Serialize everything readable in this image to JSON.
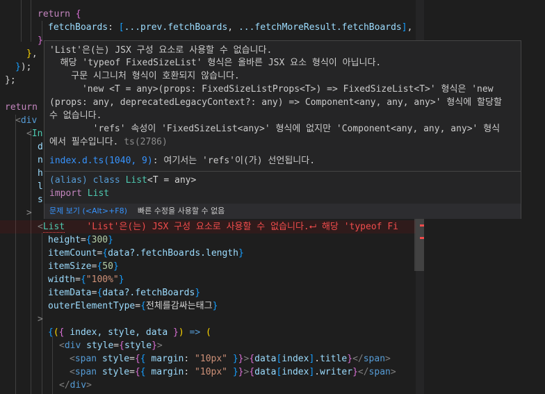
{
  "code": {
    "return_kw": "return",
    "fetchBoards_key": "fetchBoards",
    "spread_prev": "...prev.fetchBoards",
    "spread_more": "...fetchMoreResult.fetchBoards",
    "return2_kw": "return",
    "div_tag": "div",
    "infinite_tag": "In",
    "props_left": [
      "d",
      "n",
      "h",
      "l",
      "s"
    ],
    "list_tag": "List",
    "inline_error": "'List'은(는) JSX 구성 요소로 사용할 수 없습니다.⮠ 해당 'typeof Fi",
    "height_attr": "height",
    "height_val": "300",
    "itemCount_attr": "itemCount",
    "itemCount_val": "data?.fetchBoards.length",
    "itemSize_attr": "itemSize",
    "itemSize_val": "50",
    "width_attr": "width",
    "width_val": "\"100%\"",
    "itemData_attr": "itemData",
    "itemData_val": "data?.fetchBoards",
    "outer_attr": "outerElementType",
    "outer_val": "전체를감싸는태그",
    "render_params": "index, style, data",
    "div2_tag": "div",
    "style_attr": "style",
    "style_val": "style",
    "span_tag": "span",
    "margin_key": "margin",
    "margin_val": "\"10px\"",
    "title_prop": "title",
    "writer_prop": "writer",
    "data_var": "data",
    "index_var": "index"
  },
  "hover": {
    "line1": "'List'은(는) JSX 구성 요소로 사용할 수 없습니다.",
    "line2": "  해당 'typeof FixedSizeList' 형식은 올바른 JSX 요소 형식이 아닙니다.",
    "line3": "    구문 시그니처 형식이 호환되지 않습니다.",
    "line4": "      'new <T = any>(props: FixedSizeListProps<T>) => FixedSizeList<T>' 형식은 'new",
    "line5": "(props: any, deprecatedLegacyContext?: any) => Component<any, any, any>' 형식에 할당할",
    "line6": "수 없습니다.",
    "line7": "        'refs' 속성이 'FixedSizeList<any>' 형식에 없지만 'Component<any, any, any>' 형식",
    "line8": "에서 필수입니다.",
    "ts_code": "ts(2786)",
    "decl_link": "index.d.ts(1040, 9)",
    "decl_text": ": 여기서는 'refs'이(가) 선언됩니다.",
    "alias_line_kw": "(alias) class",
    "alias_line_name": "List",
    "alias_line_rest": "<T = any>",
    "import_kw": "import",
    "import_name": "List",
    "peek_label": "문제 보기 (<Alt>+F8)",
    "quickfix_label": "빠른 수정을 사용할 수 없음"
  }
}
